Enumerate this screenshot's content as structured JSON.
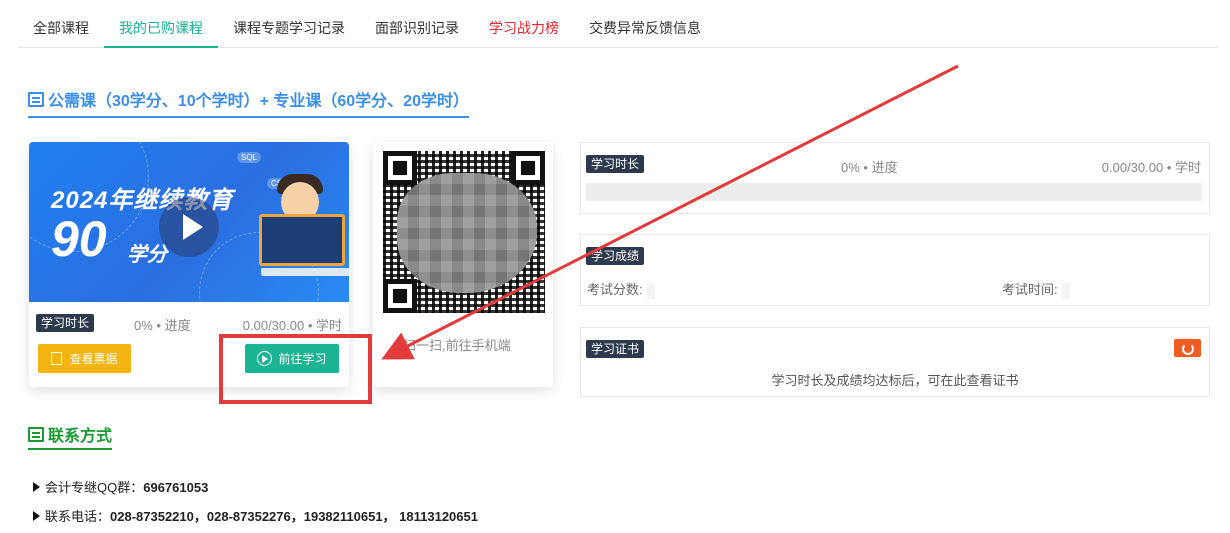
{
  "tabs": [
    {
      "label": "全部课程"
    },
    {
      "label": "我的已购课程"
    },
    {
      "label": "课程专题学习记录"
    },
    {
      "label": "面部识别记录"
    },
    {
      "label": "学习战力榜"
    },
    {
      "label": "交费异常反馈信息"
    }
  ],
  "section": {
    "title": "公需课（30学分、10个学时）+ 专业课（60学分、20学时）",
    "icon": "book-icon"
  },
  "course_card": {
    "banner_line1": "2024年继续教育",
    "banner_big": "90",
    "banner_unit": "学分",
    "banner_tags": [
      "SQL",
      "CSS"
    ],
    "study_badge": "学习时长",
    "progress_text": "0% • 进度",
    "progress_value": 0,
    "hours_text": "0.00/30.00 • 学时",
    "ticket_button": "查看票据",
    "study_button": "前往学习"
  },
  "qr_card": {
    "caption": "扫一扫,前往手机端"
  },
  "study_panel": {
    "badge": "学习时长",
    "progress_text": "0% • 进度",
    "hours_text": "0.00/30.00 • 学时",
    "progress_value": 0
  },
  "score_panel": {
    "badge": "学习成绩",
    "score_label": "考试分数:",
    "time_label": "考试时间:"
  },
  "cert_panel": {
    "badge": "学习证书",
    "note": "学习时长及成绩均达标后，可在此查看证书",
    "refresh_icon": "refresh-icon"
  },
  "contact": {
    "title": "联系方式",
    "qq_label": "会计专继QQ群：",
    "qq_value": "696761053",
    "phone_label": "联系电话：",
    "phone_value": "028-87352210，028-87352276，19382110651， 18113120651"
  },
  "colors": {
    "accent": "#1ab394",
    "section_blue": "#3b8fe6",
    "hot_tab": "#e8262e",
    "ticket_yellow": "#f5b40f",
    "badge_dark": "#2d3a4d",
    "annotation_red": "#e23b3b",
    "contact_green": "#1a9b2f"
  }
}
